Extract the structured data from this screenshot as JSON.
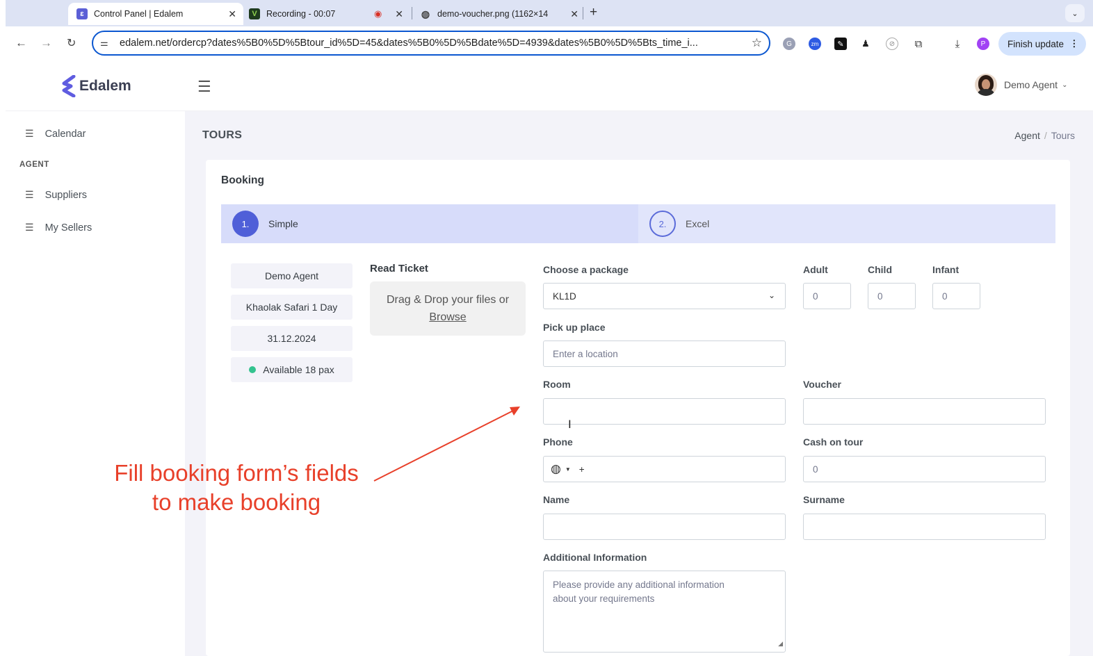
{
  "browser": {
    "tabs": [
      {
        "title": "Control Panel | Edalem",
        "icon": "edalem-icon"
      },
      {
        "title": "Recording - 00:07",
        "icon": "v-icon"
      },
      {
        "title": "demo-voucher.png (1162×14",
        "icon": "globe-icon"
      }
    ],
    "url": "edalem.net/ordercp?dates%5B0%5D%5Btour_id%5D=45&dates%5B0%5D%5Bdate%5D=4939&dates%5B0%5D%5Bts_time_i...",
    "finish_update": "Finish update",
    "profile_initial": "P"
  },
  "app": {
    "brand": "Edalem",
    "user_name": "Demo Agent",
    "accent": "#4f5fd8"
  },
  "sidebar": {
    "calendar": "Calendar",
    "section_head": "AGENT",
    "items": [
      "Suppliers",
      "My Sellers"
    ]
  },
  "page": {
    "title": "TOURS",
    "breadcrumb": [
      "Agent",
      "/",
      "Tours"
    ]
  },
  "booking": {
    "card_title": "Booking",
    "steps": [
      {
        "num": "1.",
        "label": "Simple"
      },
      {
        "num": "2.",
        "label": "Excel"
      }
    ],
    "summary": {
      "agent": "Demo Agent",
      "tour": "Khaolak Safari 1 Day",
      "date": "31.12.2024",
      "availability": "Available 18 pax"
    },
    "read_ticket": {
      "title": "Read Ticket",
      "line1": "Drag & Drop your files or",
      "browse": "Browse"
    },
    "form": {
      "package_label": "Choose a package",
      "package_value": "KL1D",
      "adult_label": "Adult",
      "adult_value": "0",
      "child_label": "Child",
      "child_value": "0",
      "infant_label": "Infant",
      "infant_value": "0",
      "pickup_label": "Pick up place",
      "pickup_placeholder": "Enter a location",
      "room_label": "Room",
      "voucher_label": "Voucher",
      "phone_label": "Phone",
      "phone_prefix": "+",
      "cash_label": "Cash on tour",
      "cash_value": "0",
      "name_label": "Name",
      "surname_label": "Surname",
      "additional_label": "Additional Information",
      "additional_placeholder_1": "Please provide any additional information",
      "additional_placeholder_2": "about your requirements"
    }
  },
  "annotation": {
    "line1": "Fill booking form’s fields",
    "line2": "to make booking",
    "color": "#e8402a"
  }
}
